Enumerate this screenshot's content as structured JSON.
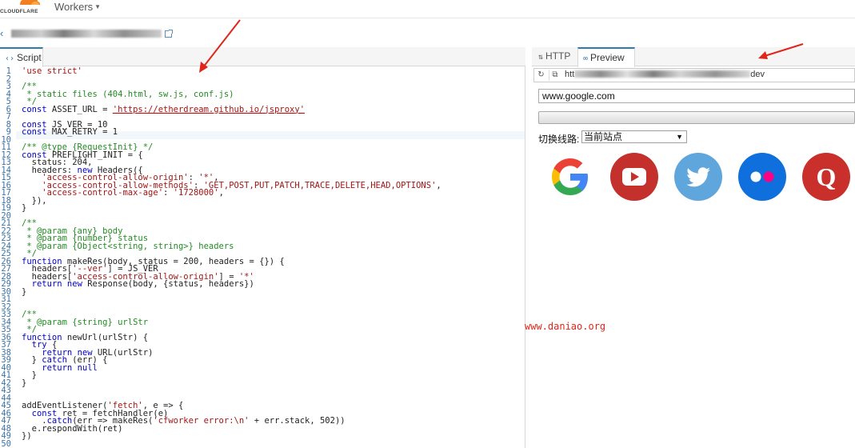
{
  "topbar": {
    "brand": "CLOUDFLARE",
    "menu_label": "Workers"
  },
  "worker": {
    "back_icon": "chevron-left-icon",
    "name_display": "",
    "external_icon": "external-link-icon"
  },
  "left_tabs": [
    {
      "label": "Script",
      "icon": "code-icon"
    }
  ],
  "right_tabs": [
    {
      "label": "HTTP",
      "icon": "arrows-icon"
    },
    {
      "label": "Preview",
      "icon": "link-icon"
    }
  ],
  "preview": {
    "url_prefix": "htt",
    "url_suffix": "dev",
    "input_value": "www.google.com",
    "route_label": "切换线路:",
    "route_selected": "当前站点"
  },
  "shortcuts": [
    {
      "name": "google",
      "icon": "google-icon",
      "bg": "#ffffff"
    },
    {
      "name": "youtube",
      "icon": "youtube-icon",
      "bg": "#c4302b"
    },
    {
      "name": "twitter",
      "icon": "twitter-icon",
      "bg": "#5fa6dc"
    },
    {
      "name": "flickr",
      "icon": "flickr-icon",
      "bg": "#0f6fdd"
    },
    {
      "name": "quora",
      "icon": "quora-icon",
      "bg": "#c9302c"
    }
  ],
  "watermark": "www.daniao.org",
  "colors": {
    "accent": "#2c7cb0",
    "annotation_arrow": "#e0251b"
  },
  "code": {
    "line_numbers": [
      "1",
      "2",
      "3",
      "4",
      "5",
      "6",
      "7",
      "8",
      "9",
      "10",
      "11",
      "12",
      "13",
      "14",
      "15",
      "16",
      "17",
      "18",
      "19",
      "20",
      "21",
      "22",
      "23",
      "24",
      "25",
      "26",
      "27",
      "28",
      "29",
      "30",
      "31",
      "32",
      "33",
      "34",
      "35",
      "36",
      "37",
      "38",
      "39",
      "40",
      "41",
      "42",
      "43",
      "44",
      "45",
      "46",
      "47",
      "48",
      "49",
      "50"
    ],
    "lines": [
      "'use strict'",
      "",
      "/**",
      " * static files (404.html, sw.js, conf.js)",
      " */",
      "const ASSET_URL = 'https://etherdream.github.io/jsproxy'",
      "",
      "const JS_VER = 10",
      "const MAX_RETRY = 1",
      "",
      "/** @type {RequestInit} */",
      "const PREFLIGHT_INIT = {",
      "  status: 204,",
      "  headers: new Headers({",
      "    'access-control-allow-origin': '*',",
      "    'access-control-allow-methods': 'GET,POST,PUT,PATCH,TRACE,DELETE,HEAD,OPTIONS',",
      "    'access-control-max-age': '1728000',",
      "  }),",
      "}",
      "",
      "/**",
      " * @param {any} body",
      " * @param {number} status",
      " * @param {Object<string, string>} headers",
      " */",
      "function makeRes(body, status = 200, headers = {}) {",
      "  headers['--ver'] = JS_VER",
      "  headers['access-control-allow-origin'] = '*'",
      "  return new Response(body, {status, headers})",
      "}",
      "",
      "",
      "/**",
      " * @param {string} urlStr",
      " */",
      "function newUrl(urlStr) {",
      "  try {",
      "    return new URL(urlStr)",
      "  } catch (err) {",
      "    return null",
      "  }",
      "}",
      "",
      "",
      "addEventListener('fetch', e => {",
      "  const ret = fetchHandler(e)",
      "    .catch(err => makeRes('cfworker error:\\n' + err.stack, 502))",
      "  e.respondWith(ret)",
      "})",
      ""
    ]
  }
}
